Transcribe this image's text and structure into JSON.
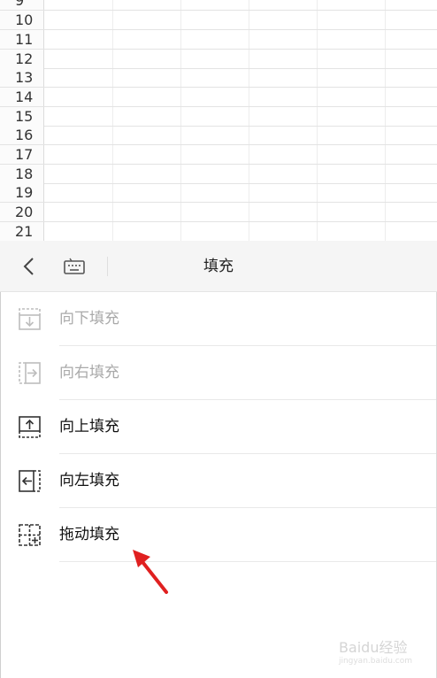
{
  "spreadsheet": {
    "rows": [
      "9",
      "10",
      "11",
      "12",
      "13",
      "14",
      "15",
      "16",
      "17",
      "18",
      "19",
      "20",
      "21"
    ]
  },
  "toolbar": {
    "title": "填充"
  },
  "menu": {
    "items": [
      {
        "label": "向下填充",
        "icon": "fill-down-icon",
        "enabled": false
      },
      {
        "label": "向右填充",
        "icon": "fill-right-icon",
        "enabled": false
      },
      {
        "label": "向上填充",
        "icon": "fill-up-icon",
        "enabled": true
      },
      {
        "label": "向左填充",
        "icon": "fill-left-icon",
        "enabled": true
      },
      {
        "label": "拖动填充",
        "icon": "drag-fill-icon",
        "enabled": true
      }
    ]
  },
  "annotation": {
    "arrow_color": "#e02020"
  },
  "watermark": {
    "text": "Baidu经验",
    "sub": "jingyan.baidu.com"
  }
}
